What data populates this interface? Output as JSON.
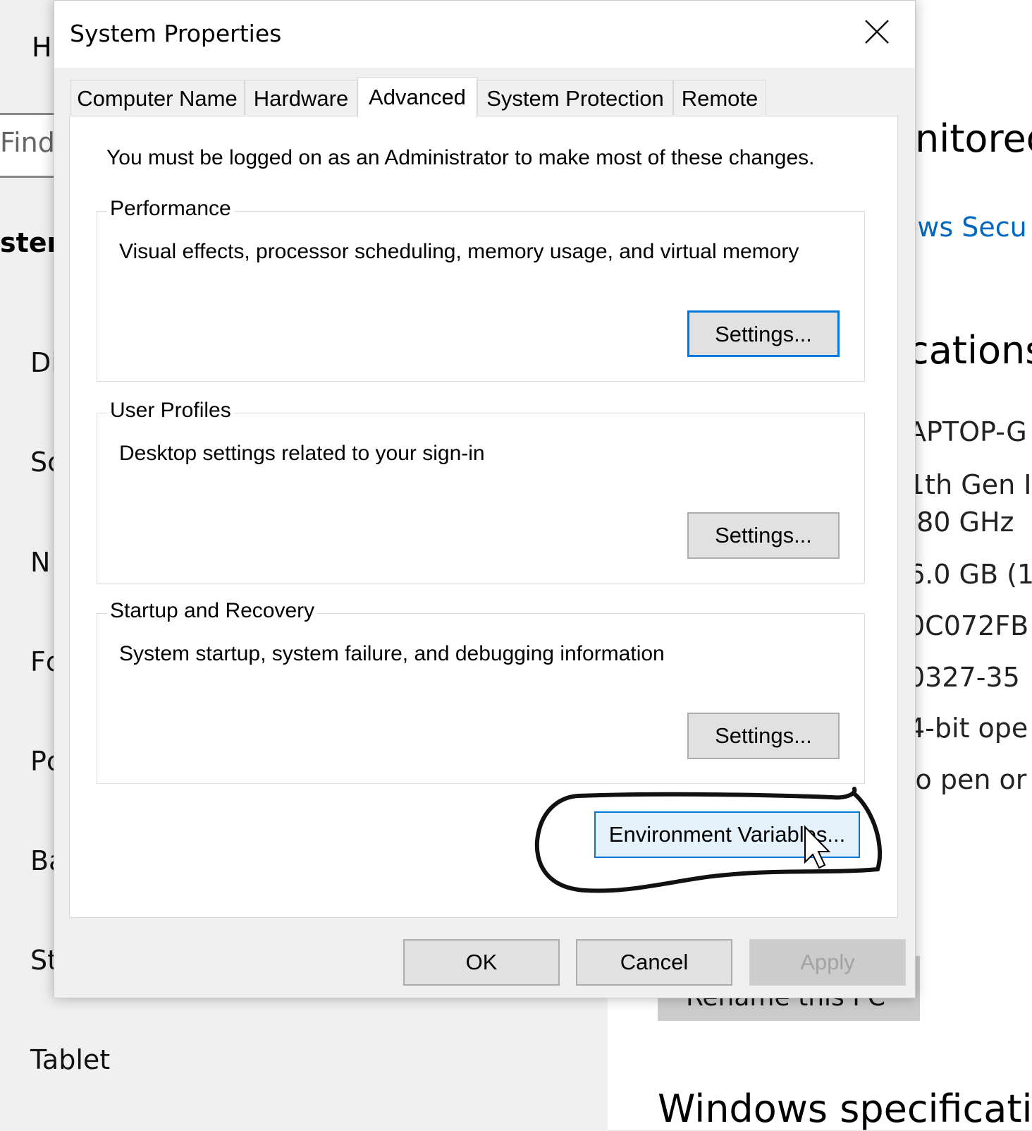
{
  "background": {
    "header_partial": "H",
    "find_partial": "Find",
    "section_partial": "stem",
    "nav_items": [
      "Di",
      "Sc",
      "N",
      "Fc",
      "Pc",
      "Ba",
      "St",
      "Tablet"
    ],
    "right_heading_partial": "nitored",
    "right_link_partial": "ows Secu",
    "right_section_partial": "cations",
    "specs": [
      "APTOP-G",
      "1th Gen I",
      ".80 GHz",
      "6.0 GB (1",
      "0C072FB",
      "0327-35",
      "4-bit ope",
      "lo pen or"
    ],
    "rename_partial": "Rename this PC",
    "windows_spec_partial": "Windows specificati",
    "link_color": "#0067c0"
  },
  "dialog": {
    "title": "System Properties",
    "tabs": [
      {
        "label": "Computer Name",
        "active": false
      },
      {
        "label": "Hardware",
        "active": false
      },
      {
        "label": "Advanced",
        "active": true
      },
      {
        "label": "System Protection",
        "active": false
      },
      {
        "label": "Remote",
        "active": false
      }
    ],
    "admin_note": "You must be logged on as an Administrator to make most of these changes.",
    "groups": {
      "performance": {
        "label": "Performance",
        "description": "Visual effects, processor scheduling, memory usage, and virtual memory",
        "button": "Settings..."
      },
      "user_profiles": {
        "label": "User Profiles",
        "description": "Desktop settings related to your sign-in",
        "button": "Settings..."
      },
      "startup_recovery": {
        "label": "Startup and Recovery",
        "description": "System startup, system failure, and debugging information",
        "button": "Settings..."
      }
    },
    "env_button": "Environment Variables...",
    "ok": "OK",
    "cancel": "Cancel",
    "apply": "Apply",
    "accent": "#0078d7"
  }
}
